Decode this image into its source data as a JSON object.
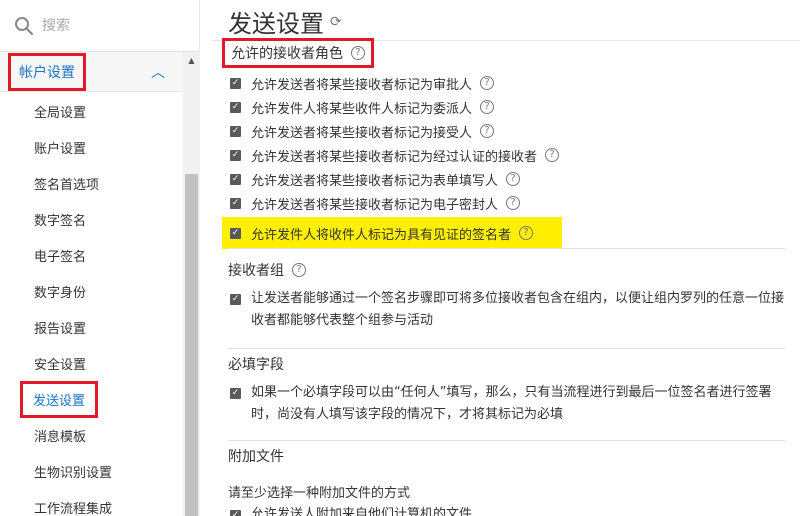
{
  "sidebar": {
    "search_placeholder": "搜索",
    "section_label": "帐户设置",
    "items": [
      {
        "label": "全局设置"
      },
      {
        "label": "账户设置"
      },
      {
        "label": "签名首选项"
      },
      {
        "label": "数字签名"
      },
      {
        "label": "电子签名"
      },
      {
        "label": "数字身份"
      },
      {
        "label": "报告设置"
      },
      {
        "label": "安全设置"
      },
      {
        "label": "发送设置",
        "active": true
      },
      {
        "label": "消息模板"
      },
      {
        "label": "生物识别设置"
      },
      {
        "label": "工作流程集成"
      }
    ]
  },
  "main": {
    "title": "发送设置",
    "recipient_roles": {
      "heading": "允许的接收者角色",
      "options": [
        "允许发送者将某些接收者标记为审批人",
        "允许发件人将某些收件人标记为委派人",
        "允许发送者将某些接收者标记为接受人",
        "允许发送者将某些接收者标记为经过认证的接收者",
        "允许发送者将某些接收者标记为表单填写人",
        "允许发送者将某些接收者标记为电子密封人",
        "允许发件人将收件人标记为具有见证的签名者"
      ]
    },
    "recipient_group": {
      "heading": "接收者组",
      "text": "让发送者能够通过一个签名步骤即可将多位接收者包含在组内，以便让组内罗列的任意一位接收者都能够代表整个组参与活动"
    },
    "required_fields": {
      "heading": "必填字段",
      "text": "如果一个必填字段可以由“任何人”填写，那么，只有当流程进行到最后一位签名者进行签署时，尚没有人填写该字段的情况下，才将其标记为必填"
    },
    "attachments": {
      "heading": "附加文件",
      "subheading": "请至少选择一种附加文件的方式",
      "option_partial": "允许发送人附加来自他们计算机的文件"
    }
  }
}
